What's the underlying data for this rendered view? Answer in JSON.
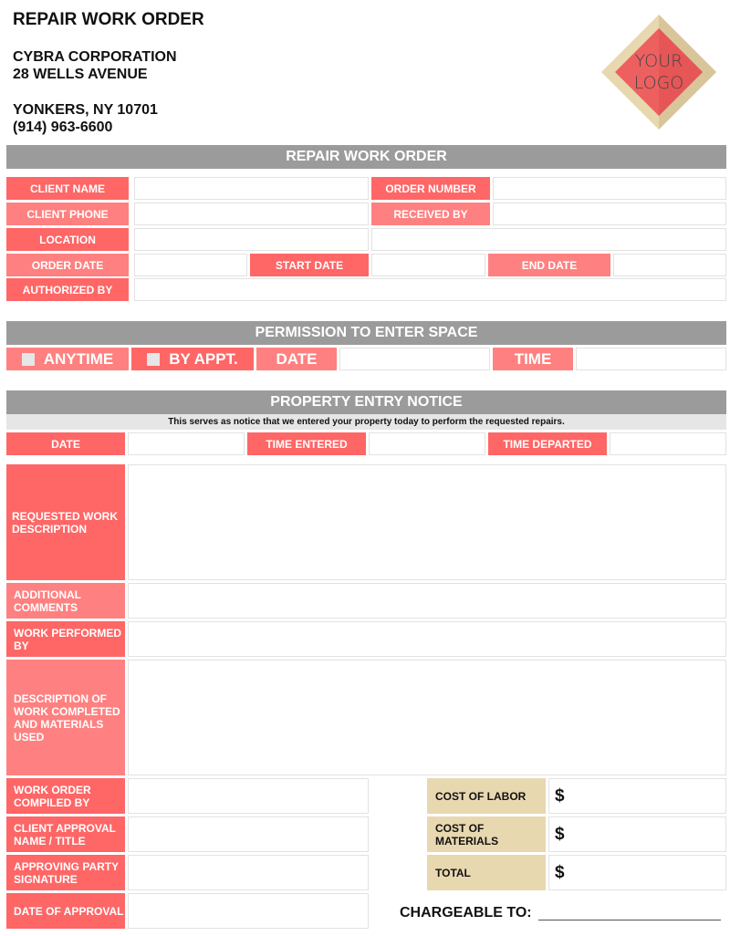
{
  "header": {
    "title": "REPAIR WORK ORDER",
    "company": "CYBRA CORPORATION",
    "street": "28 WELLS AVENUE",
    "city": "YONKERS, NY 10701",
    "phone": "(914) 963-6600",
    "logo_line1": "YOUR",
    "logo_line2": "LOGO"
  },
  "colors": {
    "label_primary": "#ff6666",
    "label_secondary": "#ff8080",
    "section_bar": "#9b9b9b",
    "cost_label": "#e8d8b0",
    "notice_bg": "#e6e6e6"
  },
  "section1": {
    "title": "REPAIR WORK ORDER",
    "client_name": {
      "label": "CLIENT NAME",
      "value": ""
    },
    "order_number": {
      "label": "ORDER NUMBER",
      "value": ""
    },
    "client_phone": {
      "label": "CLIENT PHONE",
      "value": ""
    },
    "received_by": {
      "label": "RECEIVED BY",
      "value": ""
    },
    "location": {
      "label": "LOCATION",
      "value": ""
    },
    "order_date": {
      "label": "ORDER DATE",
      "value": ""
    },
    "start_date": {
      "label": "START DATE",
      "value": ""
    },
    "end_date": {
      "label": "END DATE",
      "value": ""
    },
    "authorized_by": {
      "label": "AUTHORIZED BY",
      "value": ""
    }
  },
  "permission": {
    "title": "PERMISSION TO ENTER SPACE",
    "anytime": {
      "label": "ANYTIME",
      "checked": false
    },
    "by_appt": {
      "label": "BY APPT.",
      "checked": false
    },
    "date": {
      "label": "DATE",
      "value": ""
    },
    "time": {
      "label": "TIME",
      "value": ""
    }
  },
  "entry": {
    "title": "PROPERTY ENTRY NOTICE",
    "notice": "This serves as notice that we entered your property today to perform the requested repairs.",
    "date": {
      "label": "DATE",
      "value": ""
    },
    "time_entered": {
      "label": "TIME ENTERED",
      "value": ""
    },
    "time_departed": {
      "label": "TIME DEPARTED",
      "value": ""
    }
  },
  "work": {
    "requested": {
      "label": "REQUESTED WORK DESCRIPTION",
      "value": ""
    },
    "comments": {
      "label": "ADDITIONAL COMMENTS",
      "value": ""
    },
    "performed_by": {
      "label": "WORK PERFORMED BY",
      "value": ""
    },
    "completed": {
      "label": "DESCRIPTION OF WORK COMPLETED AND MATERIALS USED",
      "value": ""
    }
  },
  "approval": {
    "compiled_by": {
      "label": "WORK ORDER COMPILED BY",
      "value": ""
    },
    "client_approval": {
      "label": "CLIENT APPROVAL NAME / TITLE",
      "value": ""
    },
    "signature": {
      "label": "APPROVING PARTY SIGNATURE",
      "value": ""
    },
    "date": {
      "label": "DATE OF APPROVAL",
      "value": ""
    }
  },
  "costs": {
    "currency": "$",
    "labor": {
      "label": "COST OF LABOR",
      "value": ""
    },
    "materials": {
      "label": "COST OF MATERIALS",
      "value": ""
    },
    "total": {
      "label": "TOTAL",
      "value": ""
    }
  },
  "chargeable": {
    "label": "CHARGEABLE TO:",
    "value": ""
  }
}
